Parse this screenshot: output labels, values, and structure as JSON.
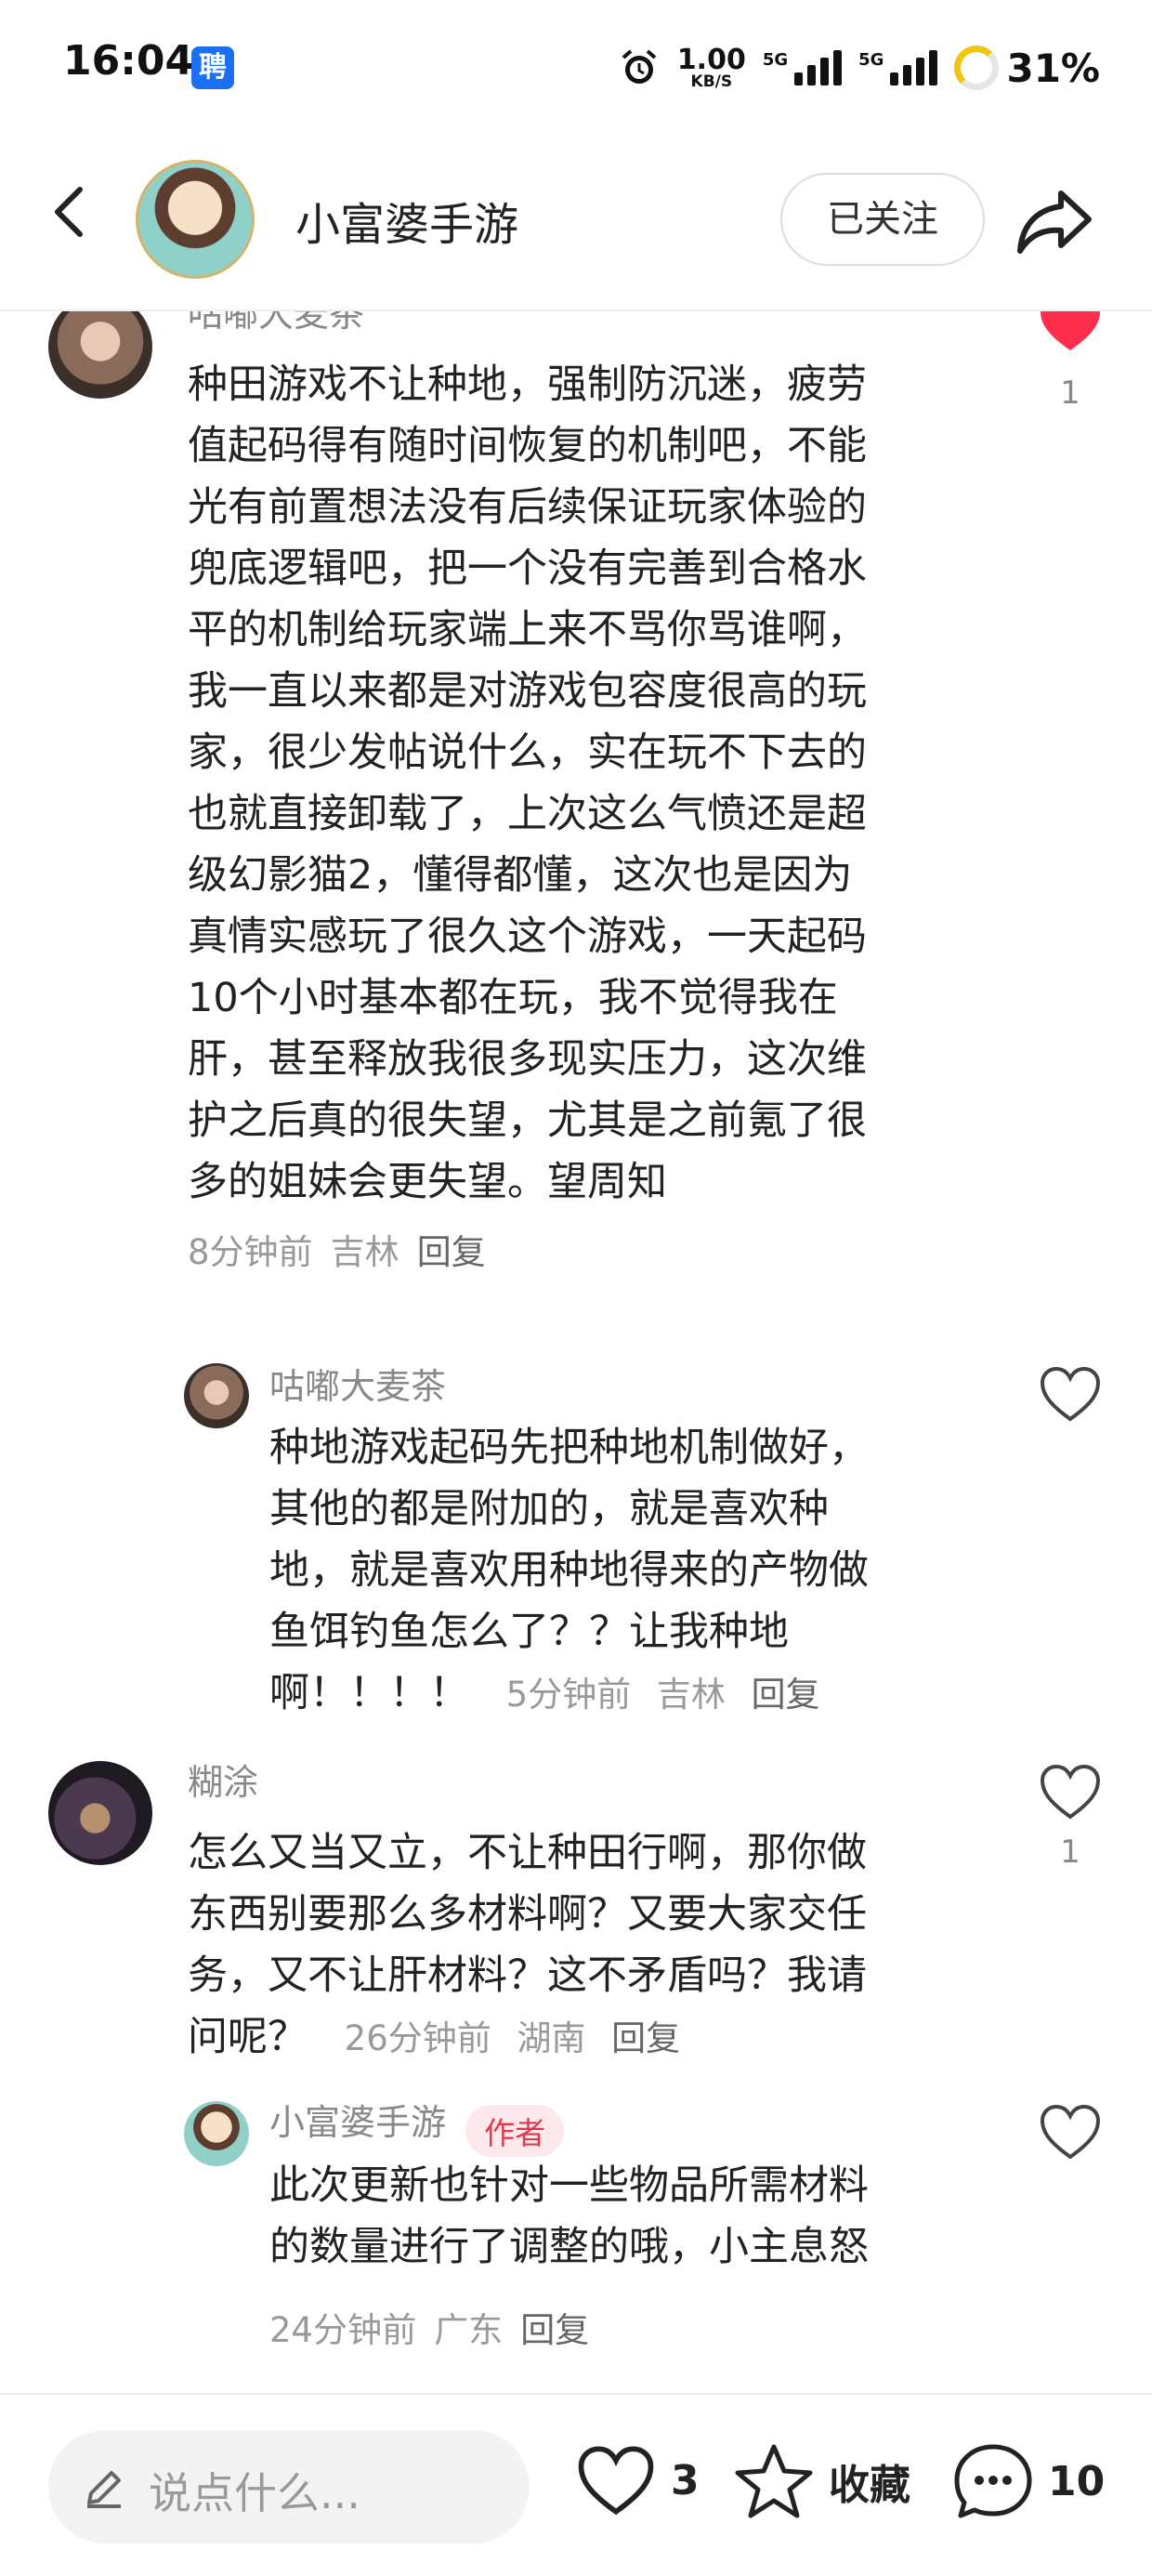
{
  "status_bar": {
    "time": "16:04",
    "app_badge": "聘",
    "net_speed": "1.00",
    "net_unit": "KB/S",
    "sim1": "5G",
    "sim2": "5G",
    "battery": "31%"
  },
  "header": {
    "title": "小富婆手游",
    "follow_label": "已关注"
  },
  "comments": [
    {
      "author": "咕嘟大麦茶",
      "text_lines": [
        "种田游戏不让种地，强制防沉迷，疲劳",
        "值起码得有随时间恢复的机制吧，不能",
        "光有前置想法没有后续保证玩家体验的",
        "兜底逻辑吧，把一个没有完善到合格水",
        "平的机制给玩家端上来不骂你骂谁啊，",
        "我一直以来都是对游戏包容度很高的玩",
        "家，很少发帖说什么，实在玩不下去的",
        "也就直接卸载了，上次这么气愤还是超",
        "级幻影猫2，懂得都懂，这次也是因为",
        "真情实感玩了很久这个游戏，一天起码",
        "10个小时基本都在玩，我不觉得我在",
        "肝，甚至释放我很多现实压力，这次维",
        "护之后真的很失望，尤其是之前氪了很",
        "多的姐妹会更失望。望周知"
      ],
      "time": "8分钟前",
      "location": "吉林",
      "reply_label": "回复",
      "likes": "1",
      "liked": true,
      "reply": {
        "author": "咕嘟大麦茶",
        "text_lines": [
          "种地游戏起码先把种地机制做好，",
          "其他的都是附加的，就是喜欢种",
          "地，就是喜欢用种地得来的产物做",
          "鱼饵钓鱼怎么了？？让我种地"
        ],
        "last_line": "啊！！！！",
        "time": "5分钟前",
        "location": "吉林",
        "reply_label": "回复"
      }
    },
    {
      "author": "糊涂",
      "text_lines": [
        "怎么又当又立，不让种田行啊，那你做",
        "东西别要那么多材料啊？又要大家交任",
        "务，又不让肝材料？这不矛盾吗？我请"
      ],
      "last_line": "问呢？",
      "time": "26分钟前",
      "location": "湖南",
      "reply_label": "回复",
      "likes": "1",
      "liked": false,
      "reply": {
        "author": "小富婆手游",
        "author_tag": "作者",
        "text_lines": [
          "此次更新也针对一些物品所需材料",
          "的数量进行了调整的哦，小主息怒"
        ],
        "time": "24分钟前",
        "location": "广东",
        "reply_label": "回复"
      }
    }
  ],
  "bottom_bar": {
    "input_placeholder": "说点什么...",
    "like_count": "3",
    "collect_label": "收藏",
    "comment_count": "10"
  },
  "colors": {
    "like_red": "#ff2e4d",
    "author_tag": "#e0384e"
  }
}
